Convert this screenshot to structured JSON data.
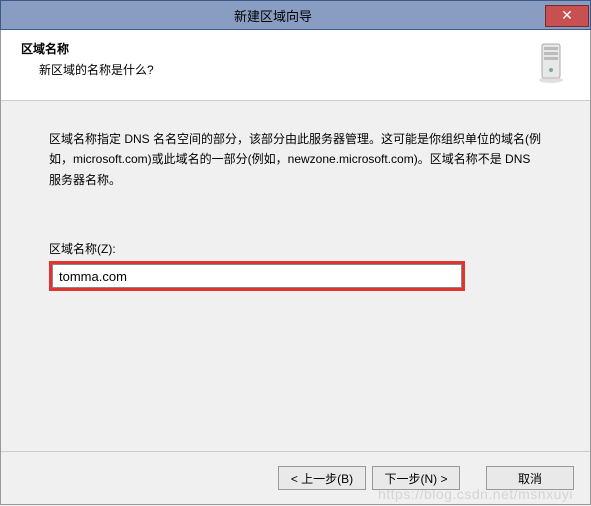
{
  "titlebar": {
    "title": "新建区域向导",
    "close_glyph": "✕"
  },
  "header": {
    "heading": "区域名称",
    "sub": "新区域的名称是什么?"
  },
  "content": {
    "description": "区域名称指定 DNS 名名空间的部分，该部分由此服务器管理。这可能是你组织单位的域名(例如，microsoft.com)或此域名的一部分(例如，newzone.microsoft.com)。区域名称不是 DNS 服务器名称。",
    "field_label": "区域名称(Z):",
    "field_value": "tomma.com"
  },
  "buttons": {
    "back": "< 上一步(B)",
    "next": "下一步(N) >",
    "cancel": "取消"
  },
  "watermark": "https://blog.csdn.net/msnxuyi"
}
